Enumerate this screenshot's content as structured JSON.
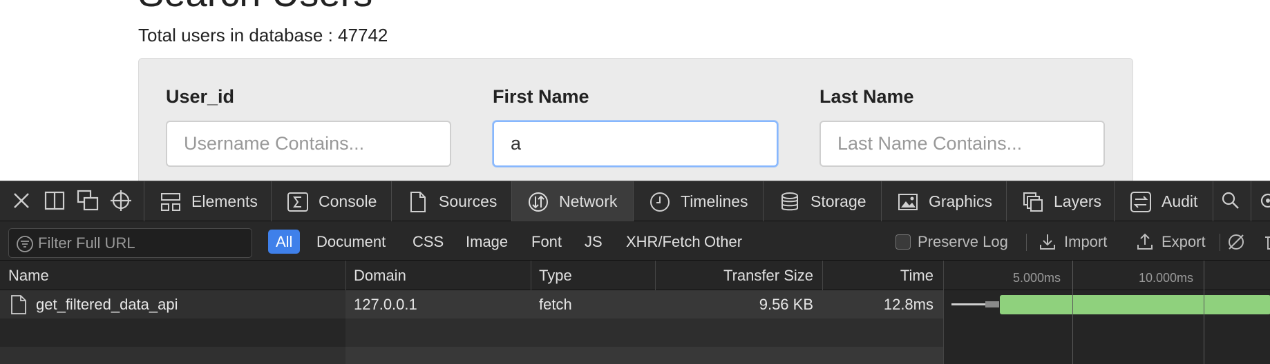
{
  "page": {
    "title": "Search Users",
    "total_users_label": "Total users in database : 47742"
  },
  "form": {
    "fields": [
      {
        "label": "User_id",
        "value": "",
        "placeholder": "Username Contains..."
      },
      {
        "label": "First Name",
        "value": "a",
        "placeholder": ""
      },
      {
        "label": "Last Name",
        "value": "",
        "placeholder": "Last Name Contains..."
      }
    ]
  },
  "devtools": {
    "controls": [
      "close-icon",
      "dock-side-icon",
      "undock-icon",
      "inspect-icon"
    ],
    "tabs": [
      {
        "label": "Elements",
        "icon": "elements-icon"
      },
      {
        "label": "Console",
        "icon": "console-icon"
      },
      {
        "label": "Sources",
        "icon": "sources-icon"
      },
      {
        "label": "Network",
        "icon": "network-icon",
        "active": true
      },
      {
        "label": "Timelines",
        "icon": "timelines-icon"
      },
      {
        "label": "Storage",
        "icon": "storage-icon"
      },
      {
        "label": "Graphics",
        "icon": "graphics-icon"
      },
      {
        "label": "Layers",
        "icon": "layers-icon"
      },
      {
        "label": "Audit",
        "icon": "audit-icon"
      }
    ],
    "filter": {
      "placeholder": "Filter Full URL",
      "types": [
        "All",
        "Document",
        "CSS",
        "Image",
        "Font",
        "JS",
        "XHR/Fetch",
        "Other"
      ],
      "active_type": "All",
      "preserve_log": "Preserve Log",
      "import": "Import",
      "export": "Export"
    },
    "network": {
      "columns": [
        "Name",
        "Domain",
        "Type",
        "Transfer Size",
        "Time"
      ],
      "timeline_ticks": [
        "5.000ms",
        "10.000ms"
      ],
      "rows": [
        {
          "name": "get_filtered_data_api",
          "domain": "127.0.0.1",
          "type": "fetch",
          "transfer_size": "9.56 KB",
          "time": "12.8ms"
        }
      ]
    },
    "colors": {
      "accent": "#3f80ea",
      "timing_bar": "#8fd17d",
      "background": "#1e1e1e"
    }
  }
}
